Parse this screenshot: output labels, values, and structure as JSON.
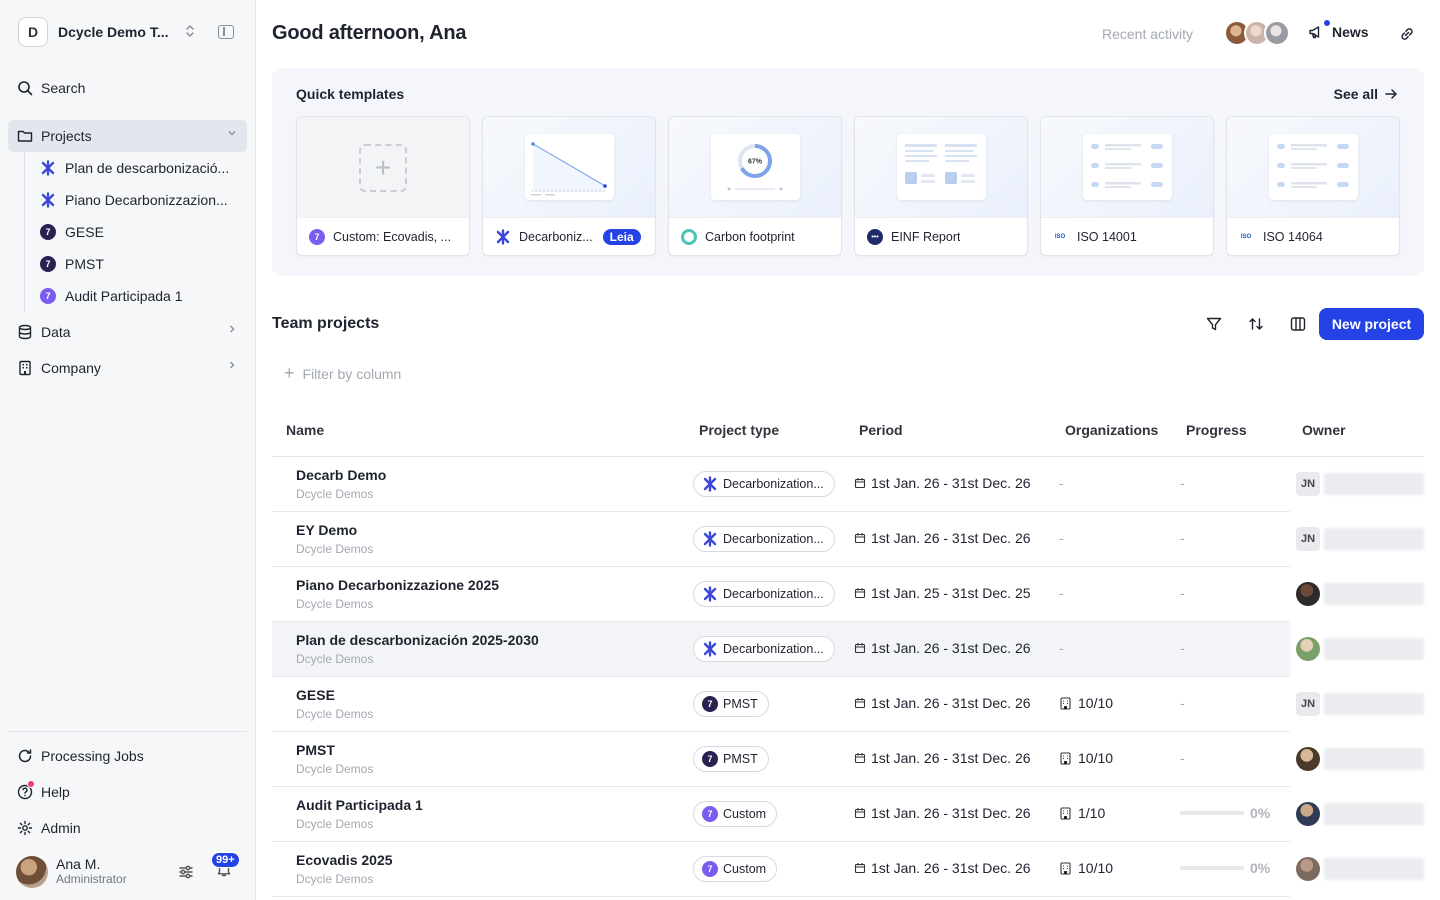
{
  "workspace": {
    "initial": "D",
    "name": "Dcycle Demo T..."
  },
  "nav": {
    "search": "Search",
    "projects": "Projects",
    "project_items": [
      {
        "label": "Plan de descarbonizació...",
        "icon": "decarb-star-icon"
      },
      {
        "label": "Piano Decarbonizzazion...",
        "icon": "decarb-star-icon"
      },
      {
        "label": "GESE",
        "icon": "pmst-logo-icon"
      },
      {
        "label": "PMST",
        "icon": "pmst-logo-icon"
      },
      {
        "label": "Audit Participada 1",
        "icon": "custom-logo-icon"
      }
    ],
    "data": "Data",
    "company": "Company",
    "processing_jobs": "Processing Jobs",
    "help": "Help",
    "admin": "Admin"
  },
  "user": {
    "name": "Ana M.",
    "role": "Administrator",
    "notifications": "99+"
  },
  "header": {
    "greeting": "Good afternoon, Ana",
    "recent_activity": "Recent activity",
    "news": "News"
  },
  "templates": {
    "title": "Quick templates",
    "see_all": "See all",
    "items": [
      {
        "label": "Custom: Ecovadis, ..."
      },
      {
        "label": "Decarboniz...",
        "tag": "Leia"
      },
      {
        "label": "Carbon footprint",
        "ring": "67%"
      },
      {
        "label": "EINF Report"
      },
      {
        "label": "ISO 14001",
        "badge": "ISO"
      },
      {
        "label": "ISO 14064",
        "badge": "ISO"
      }
    ]
  },
  "team_projects": {
    "title": "Team projects",
    "new_project": "New project",
    "filter_placeholder": "Filter by column",
    "columns": {
      "name": "Name",
      "type": "Project type",
      "period": "Period",
      "orgs": "Organizations",
      "progress": "Progress",
      "owner": "Owner"
    },
    "rows": [
      {
        "name": "Decarb Demo",
        "org": "Dcycle Demos",
        "type": "Decarbonization...",
        "type_icon": "star",
        "period": "1st Jan. 26 - 31st Dec. 26",
        "orgs": "-",
        "progress": "-",
        "owner_initials": "JN"
      },
      {
        "name": "EY Demo",
        "org": "Dcycle Demos",
        "type": "Decarbonization...",
        "type_icon": "star",
        "period": "1st Jan. 26 - 31st Dec. 26",
        "orgs": "-",
        "progress": "-",
        "owner_initials": "JN"
      },
      {
        "name": "Piano Decarbonizzazione 2025",
        "org": "Dcycle Demos",
        "type": "Decarbonization...",
        "type_icon": "star",
        "period": "1st Jan. 25 - 31st Dec. 25",
        "orgs": "-",
        "progress": "-",
        "owner_initials": ""
      },
      {
        "name": "Plan de descarbonización 2025-2030",
        "org": "Dcycle Demos",
        "type": "Decarbonization...",
        "type_icon": "star",
        "period": "1st Jan. 26 - 31st Dec. 26",
        "orgs": "-",
        "progress": "-",
        "owner_initials": ""
      },
      {
        "name": "GESE",
        "org": "Dcycle Demos",
        "type": "PMST",
        "type_icon": "dark",
        "period": "1st Jan. 26 - 31st Dec. 26",
        "orgs": "10/10",
        "progress": "-",
        "owner_initials": "JN"
      },
      {
        "name": "PMST",
        "org": "Dcycle Demos",
        "type": "PMST",
        "type_icon": "dark",
        "period": "1st Jan. 26 - 31st Dec. 26",
        "orgs": "10/10",
        "progress": "-",
        "owner_initials": ""
      },
      {
        "name": "Audit Participada 1",
        "org": "Dcycle Demos",
        "type": "Custom",
        "type_icon": "purple",
        "period": "1st Jan. 26 - 31st Dec. 26",
        "orgs": "1/10",
        "progress": "0%",
        "owner_initials": ""
      },
      {
        "name": "Ecovadis 2025",
        "org": "Dcycle Demos",
        "type": "Custom",
        "type_icon": "purple",
        "period": "1st Jan. 26 - 31st Dec. 26",
        "orgs": "10/10",
        "progress": "0%",
        "owner_initials": ""
      }
    ]
  },
  "colors": {
    "primary": "#2442e6",
    "sidebar_bg": "#f6f7f9",
    "panel_bg": "#f4f6fb",
    "pmst_dark": "#2b2151",
    "custom_purple": "#7b5cf0"
  }
}
